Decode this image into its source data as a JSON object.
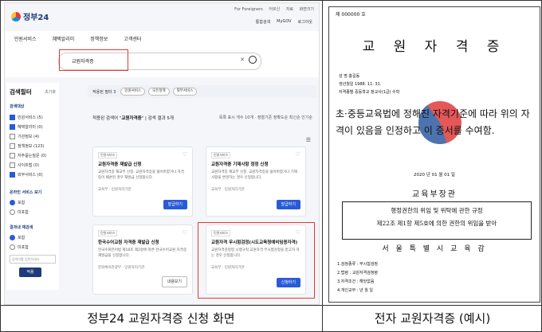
{
  "captions": {
    "left": "정부24 교원자격증 신청 화면",
    "right": "전자 교원자격증 (예시)"
  },
  "portal": {
    "logo": "정부24",
    "utility": [
      "For Foreigners",
      "어르신",
      "자료",
      "화면크기"
    ],
    "header_icons": [
      "통합검색",
      "MyGOV",
      "로그아웃"
    ],
    "nav": [
      "민원서비스",
      "혜택알리미",
      "정책정보",
      "고객센터"
    ],
    "search": {
      "value": "교원자격증"
    },
    "sidebar": {
      "title": "검색필터",
      "reset": "초기화",
      "service_type_heading": "검색대상",
      "service_types": [
        "민원서비스 (5)",
        "혜택알리미 (0)",
        "기관정보 (4)",
        "정책정보 (123)",
        "자주묻는질문 (0)",
        "사이트맵 (0)",
        "외부서비스 (0)"
      ],
      "online_heading": "온라인 서비스 보기",
      "online_options": [
        "포함",
        "미포함"
      ],
      "refine_heading": "결과내 재검색",
      "refine_options": [
        "포함",
        "미포함"
      ],
      "refine_placeholder": "검색어를 입력하세요",
      "apply": "적용"
    },
    "chips": {
      "label": "적용된 필터 3",
      "items": [
        "민원서비스",
        "모든정책",
        "외부서비스"
      ]
    },
    "result_summary": {
      "prefix": "적용된 검색어",
      "query": "교원자격증",
      "count_text": "검색 결과 5개"
    },
    "sort": "목록 표시 개수 10개 · 정렬기준 정확도순 최신순 인기순",
    "cards": [
      {
        "tag": "민원서비스",
        "title": "교원자격증 재발급 신청",
        "desc": "교원자격증 재교부 신청. 교원자격증을 잃어버렸거나 자격증이 훼손된 경우 재발급 신청합니다.",
        "org": "교육부 · 민원처리기관",
        "button": "발급하기"
      },
      {
        "tag": "민원서비스",
        "title": "교원자격증 기재사항 정정 신청",
        "desc": "교원자격증 재교부 신청. 교원자격증을 잃어버렸거나 기재사항을 변경하는 경우 신청합니다.",
        "org": "교육부 · 민원처리기관",
        "button": "발급하기"
      },
      {
        "tag": "민원서비스",
        "title": "한국수어교원 자격증 재발급 신청",
        "desc": "한국수화언어법 제18조 제2항에 따른 한국수어교원 자격증 재발급을 신청합니다.",
        "org": "문화체육관광부 · 민원처리기관",
        "button": "내용보기"
      },
      {
        "tag": "민원서비스",
        "title": "교원자격 무시험검정(시도교육청예비임용자격)",
        "desc": "교원자격검정령 시행규칙 교원자격 무시험검정을 받고자 하는 경우 신청합니다.",
        "org": "교육부 · 민원처리기관",
        "button": "신청하기"
      }
    ]
  },
  "certificate": {
    "number": "제 000000 호",
    "heading": "교 원 자 격 증",
    "name_line": "성    명  홍길동",
    "birth_line": "생년월일  1988. 11. 31.",
    "grade_line": "자격종별  중등학교 정교사(1급) 수학",
    "body": "초·중등교육법에 정해진 자격기준에 따라 위의 자격이 있음을 인정하고 이 증서를 수여함.",
    "date": "2020 년 01 월 01 일",
    "issuer": "교육부장관",
    "box_lines": [
      "행정권한의 위임 및 위탁에 관한 규정",
      "제22조 제1항 제5호에 의한 권한의 위임을 받아"
    ],
    "office": "서 울 특 별 시 교 육 감",
    "footer": [
      "1.검정종류 : 무시험검정",
      "2.법령 : 교원자격검정령",
      "3.자격조건 : 해당없음",
      "4.개인교부 : 년  월  일"
    ]
  }
}
